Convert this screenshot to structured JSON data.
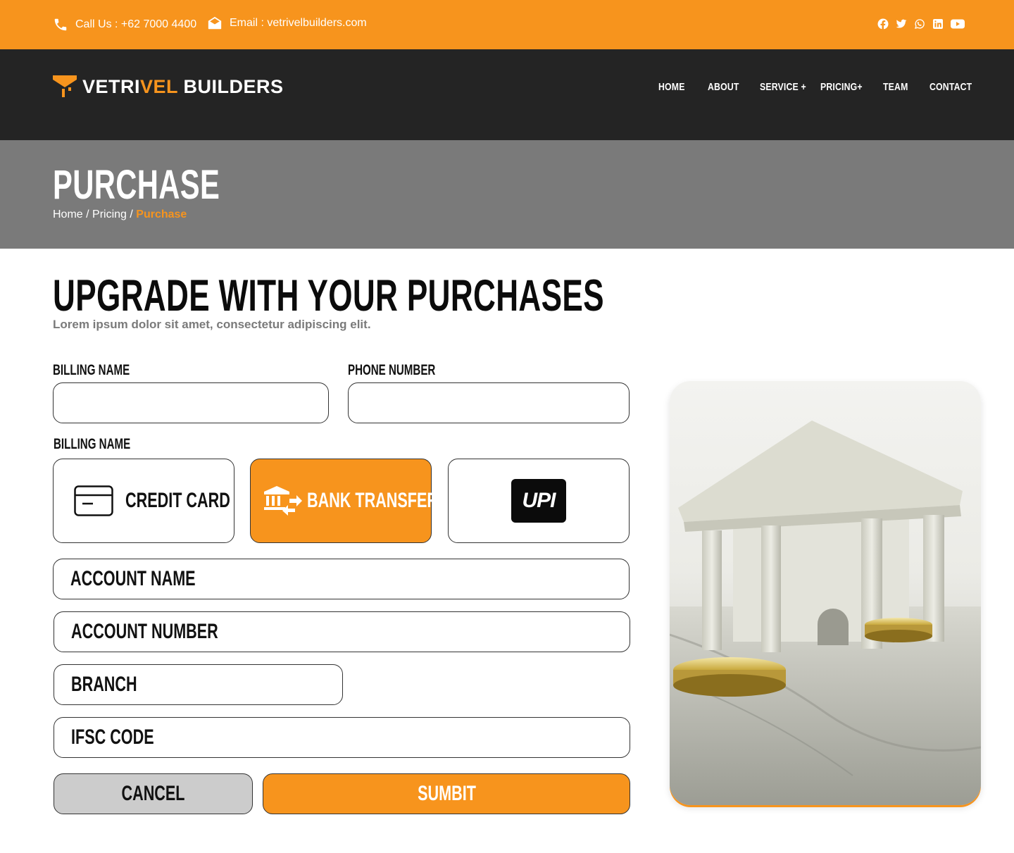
{
  "topbar": {
    "phone": "Call Us : +62 7000 4400",
    "email": "Email : vetrivelbuilders.com",
    "socials": [
      "facebook-icon",
      "twitter-icon",
      "whatsapp-icon",
      "linkedin-icon",
      "youtube-icon"
    ]
  },
  "brand": {
    "part1": "VETRI",
    "part2": "VEL",
    "part3": " BUILDERS"
  },
  "nav": {
    "home": "HOME",
    "about": "ABOUT",
    "service": "SERVICE +",
    "pricing": "PRICING+",
    "team": "TEAM",
    "contact": "CONTACT"
  },
  "banner": {
    "title": "PURCHASE",
    "crumb_home": "Home",
    "crumb_sep1": " / ",
    "crumb_pricing": "Pricing",
    "crumb_sep2": " / ",
    "crumb_current": "Purchase"
  },
  "main": {
    "title": "UPGRADE WITH YOUR PURCHASES",
    "subtitle": "Lorem ipsum dolor sit amet, consectetur adipiscing elit."
  },
  "form": {
    "billing_name_label": "BILLING NAME",
    "phone_label": "PHONE NUMBER",
    "payment_label": "BILLING NAME",
    "credit_card": "CREDIT CARD",
    "bank_transfer": "BANK TRANSFER",
    "upi": "UPI",
    "account_name": "ACCOUNT NAME",
    "account_number": "ACCOUNT NUMBER",
    "branch": "BRANCH",
    "ifsc": "IFSC CODE",
    "cancel": "CANCEL",
    "submit": "SUMBIT",
    "selected_method": "bank_transfer"
  },
  "colors": {
    "accent": "#F7941D",
    "dark": "#242424",
    "banner": "#7A7A7A"
  }
}
